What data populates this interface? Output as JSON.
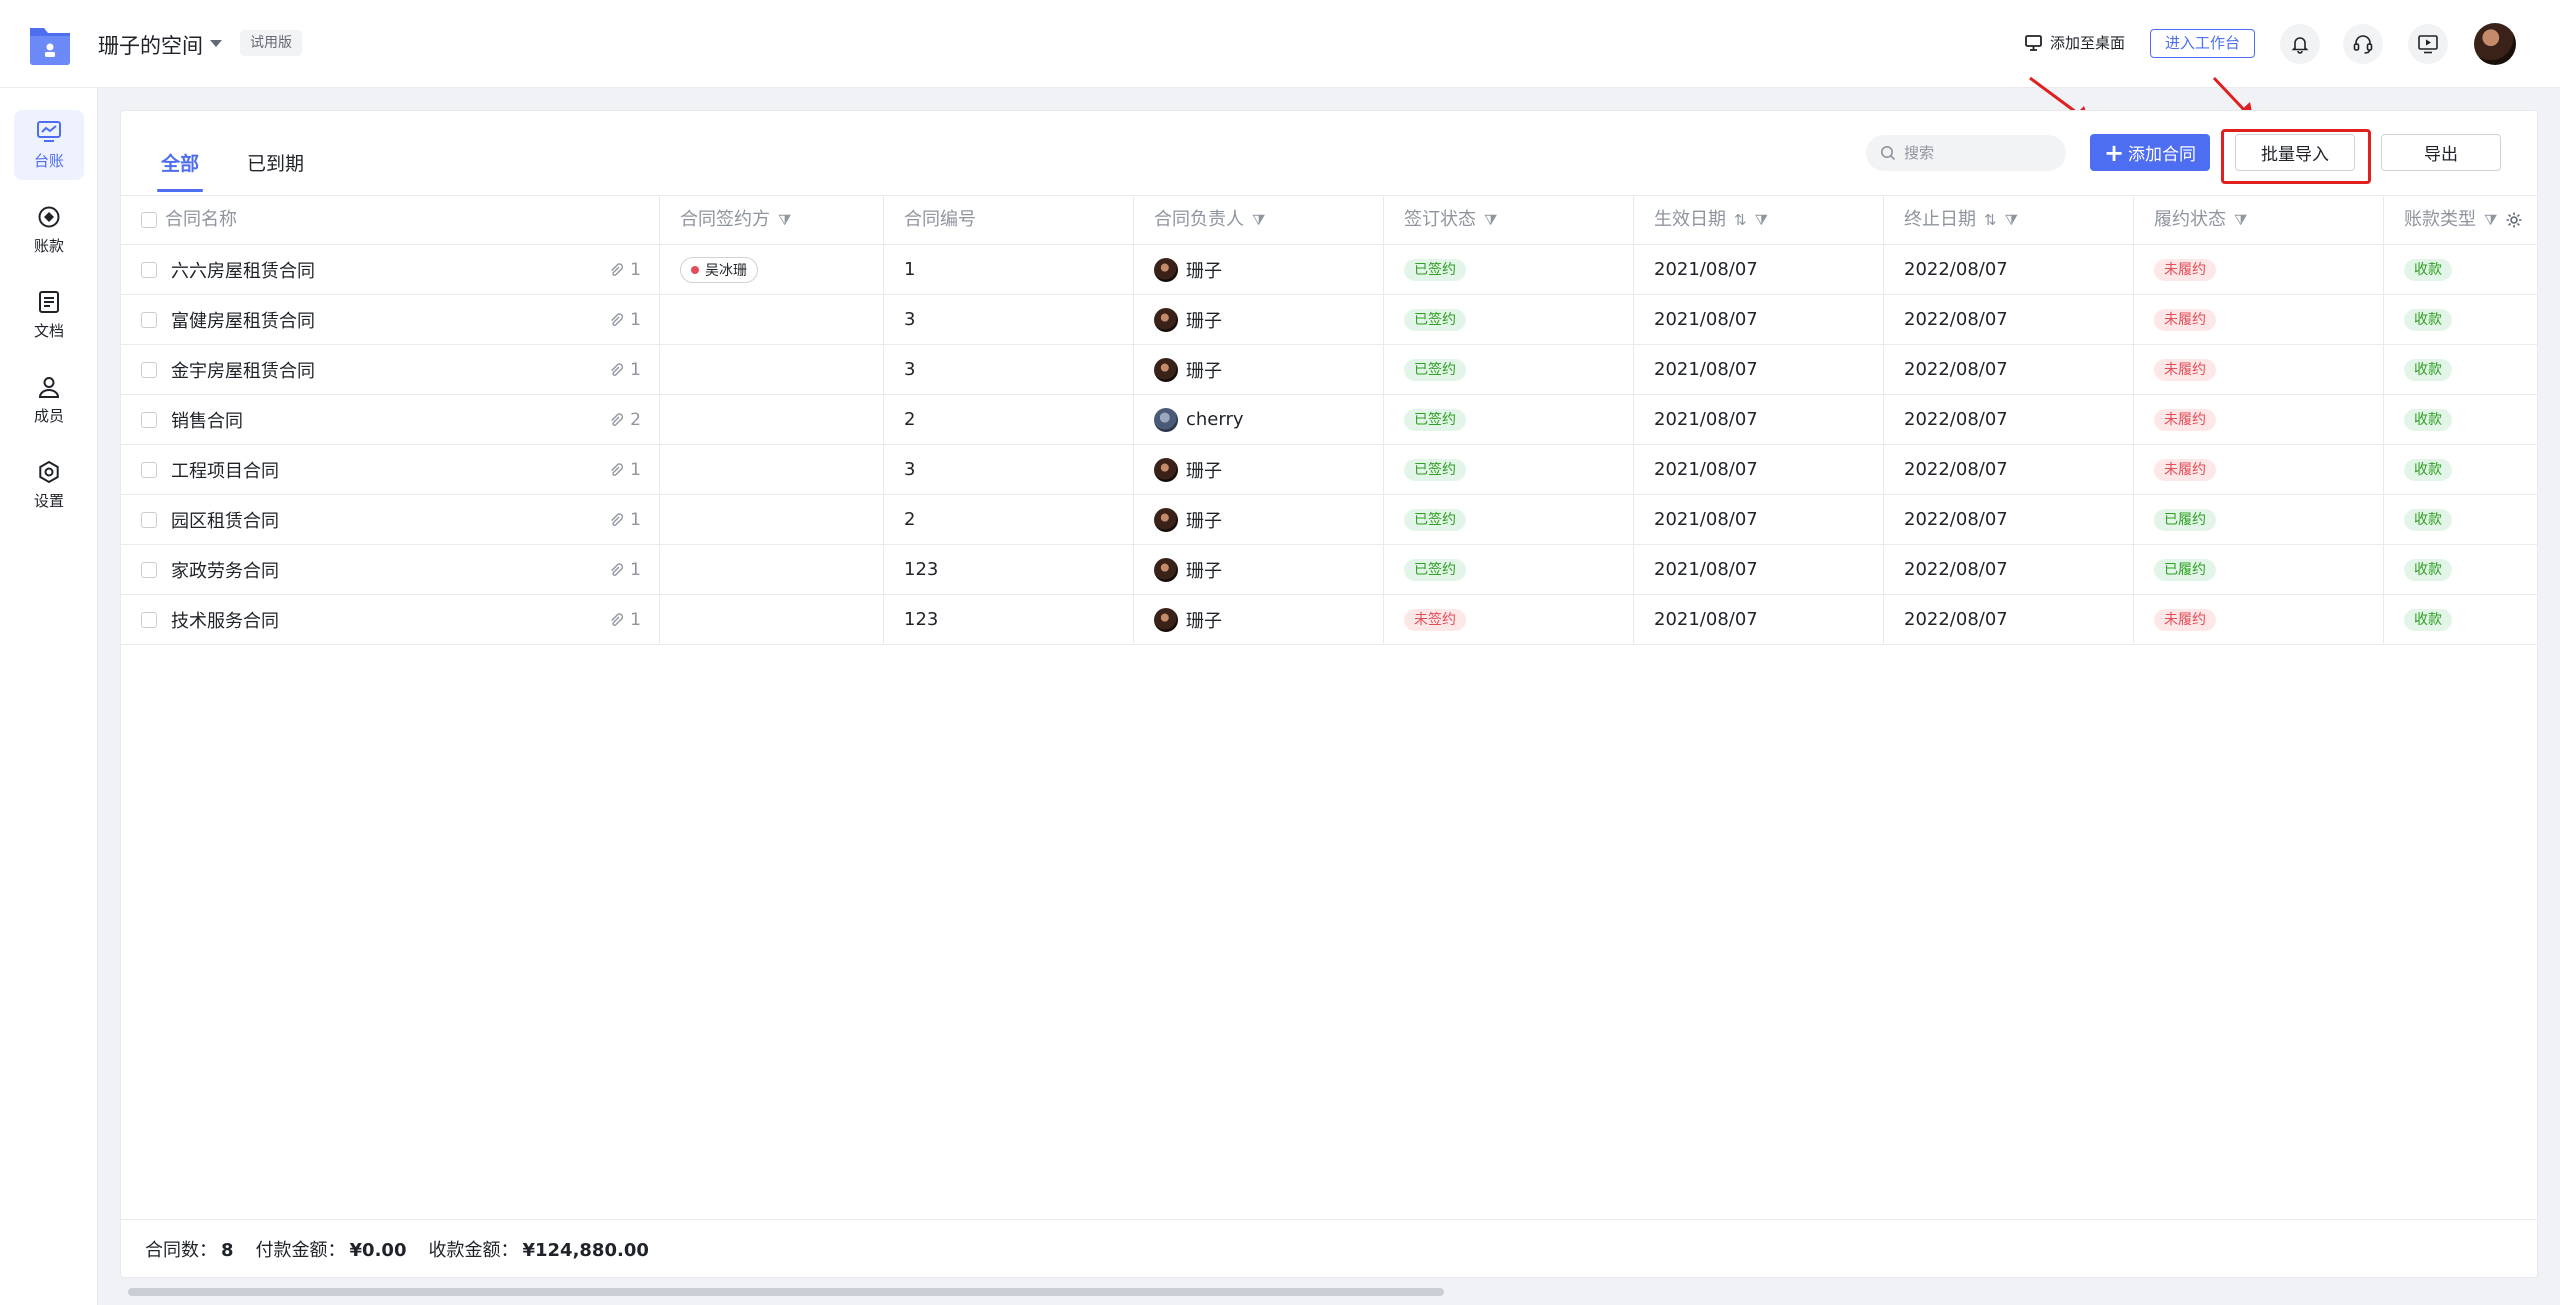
{
  "header": {
    "space_name": "珊子的空间",
    "trial_label": "试用版",
    "add_desktop_label": "添加至桌面",
    "enter_workbench_label": "进入工作台"
  },
  "sidebar": {
    "items": [
      {
        "label": "台账",
        "icon": "ledger-chart-icon",
        "active": true
      },
      {
        "label": "账款",
        "icon": "payment-icon",
        "active": false
      },
      {
        "label": "文档",
        "icon": "document-icon",
        "active": false
      },
      {
        "label": "成员",
        "icon": "member-icon",
        "active": false
      },
      {
        "label": "设置",
        "icon": "settings-icon",
        "active": false
      }
    ]
  },
  "tabs": [
    {
      "label": "全部",
      "active": true
    },
    {
      "label": "已到期",
      "active": false
    }
  ],
  "toolbar": {
    "search_placeholder": "搜索",
    "add_contract_label": "添加合同",
    "batch_import_label": "批量导入",
    "export_label": "导出"
  },
  "table": {
    "columns": [
      "合同名称",
      "合同签约方",
      "合同编号",
      "合同负责人",
      "签订状态",
      "生效日期",
      "终止日期",
      "履约状态",
      "账款类型"
    ],
    "rows": [
      {
        "name": "六六房屋租赁合同",
        "attachments": "1",
        "party": "吴冰珊",
        "number": "1",
        "owner": "珊子",
        "sign_status": "已签约",
        "sign_ok": true,
        "start": "2021/08/07",
        "end": "2022/08/07",
        "perform_status": "未履约",
        "perform_ok": false,
        "payment_type": "收款"
      },
      {
        "name": "富健房屋租赁合同",
        "attachments": "1",
        "party": "",
        "number": "3",
        "owner": "珊子",
        "sign_status": "已签约",
        "sign_ok": true,
        "start": "2021/08/07",
        "end": "2022/08/07",
        "perform_status": "未履约",
        "perform_ok": false,
        "payment_type": "收款"
      },
      {
        "name": "金宇房屋租赁合同",
        "attachments": "1",
        "party": "",
        "number": "3",
        "owner": "珊子",
        "sign_status": "已签约",
        "sign_ok": true,
        "start": "2021/08/07",
        "end": "2022/08/07",
        "perform_status": "未履约",
        "perform_ok": false,
        "payment_type": "收款"
      },
      {
        "name": "销售合同",
        "attachments": "2",
        "party": "",
        "number": "2",
        "owner": "cherry",
        "sign_status": "已签约",
        "sign_ok": true,
        "start": "2021/08/07",
        "end": "2022/08/07",
        "perform_status": "未履约",
        "perform_ok": false,
        "payment_type": "收款"
      },
      {
        "name": "工程项目合同",
        "attachments": "1",
        "party": "",
        "number": "3",
        "owner": "珊子",
        "sign_status": "已签约",
        "sign_ok": true,
        "start": "2021/08/07",
        "end": "2022/08/07",
        "perform_status": "未履约",
        "perform_ok": false,
        "payment_type": "收款"
      },
      {
        "name": "园区租赁合同",
        "attachments": "1",
        "party": "",
        "number": "2",
        "owner": "珊子",
        "sign_status": "已签约",
        "sign_ok": true,
        "start": "2021/08/07",
        "end": "2022/08/07",
        "perform_status": "已履约",
        "perform_ok": true,
        "payment_type": "收款"
      },
      {
        "name": "家政劳务合同",
        "attachments": "1",
        "party": "",
        "number": "123",
        "owner": "珊子",
        "sign_status": "已签约",
        "sign_ok": true,
        "start": "2021/08/07",
        "end": "2022/08/07",
        "perform_status": "已履约",
        "perform_ok": true,
        "payment_type": "收款"
      },
      {
        "name": "技术服务合同",
        "attachments": "1",
        "party": "",
        "number": "123",
        "owner": "珊子",
        "sign_status": "未签约",
        "sign_ok": false,
        "start": "2021/08/07",
        "end": "2022/08/07",
        "perform_status": "未履约",
        "perform_ok": false,
        "payment_type": "收款"
      }
    ]
  },
  "footer": {
    "count_label": "合同数：",
    "count_value": "8",
    "pay_label": "付款金额：",
    "pay_value": "¥0.00",
    "receive_label": "收款金额：",
    "receive_value": "¥124,880.00"
  },
  "colors": {
    "accent": "#4e6ef2",
    "highlight": "#e02020",
    "success": "#2ea121",
    "danger": "#e34d59"
  }
}
